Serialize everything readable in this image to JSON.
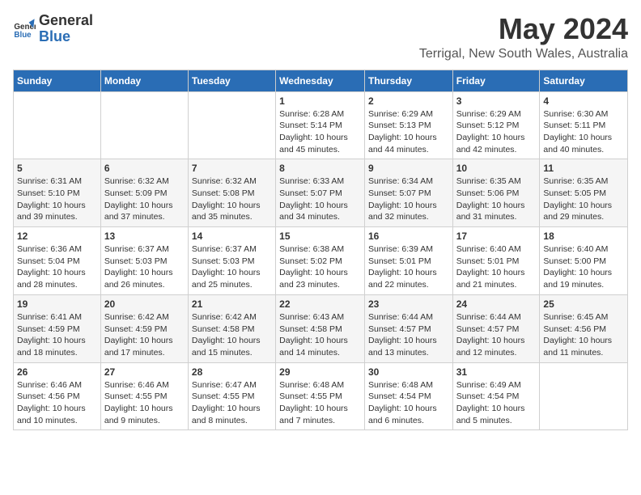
{
  "header": {
    "logo_general": "General",
    "logo_blue": "Blue",
    "title": "May 2024",
    "subtitle": "Terrigal, New South Wales, Australia"
  },
  "columns": [
    "Sunday",
    "Monday",
    "Tuesday",
    "Wednesday",
    "Thursday",
    "Friday",
    "Saturday"
  ],
  "weeks": [
    {
      "days": [
        {
          "num": "",
          "detail": ""
        },
        {
          "num": "",
          "detail": ""
        },
        {
          "num": "",
          "detail": ""
        },
        {
          "num": "1",
          "detail": "Sunrise: 6:28 AM\nSunset: 5:14 PM\nDaylight: 10 hours and 45 minutes."
        },
        {
          "num": "2",
          "detail": "Sunrise: 6:29 AM\nSunset: 5:13 PM\nDaylight: 10 hours and 44 minutes."
        },
        {
          "num": "3",
          "detail": "Sunrise: 6:29 AM\nSunset: 5:12 PM\nDaylight: 10 hours and 42 minutes."
        },
        {
          "num": "4",
          "detail": "Sunrise: 6:30 AM\nSunset: 5:11 PM\nDaylight: 10 hours and 40 minutes."
        }
      ]
    },
    {
      "days": [
        {
          "num": "5",
          "detail": "Sunrise: 6:31 AM\nSunset: 5:10 PM\nDaylight: 10 hours and 39 minutes."
        },
        {
          "num": "6",
          "detail": "Sunrise: 6:32 AM\nSunset: 5:09 PM\nDaylight: 10 hours and 37 minutes."
        },
        {
          "num": "7",
          "detail": "Sunrise: 6:32 AM\nSunset: 5:08 PM\nDaylight: 10 hours and 35 minutes."
        },
        {
          "num": "8",
          "detail": "Sunrise: 6:33 AM\nSunset: 5:07 PM\nDaylight: 10 hours and 34 minutes."
        },
        {
          "num": "9",
          "detail": "Sunrise: 6:34 AM\nSunset: 5:07 PM\nDaylight: 10 hours and 32 minutes."
        },
        {
          "num": "10",
          "detail": "Sunrise: 6:35 AM\nSunset: 5:06 PM\nDaylight: 10 hours and 31 minutes."
        },
        {
          "num": "11",
          "detail": "Sunrise: 6:35 AM\nSunset: 5:05 PM\nDaylight: 10 hours and 29 minutes."
        }
      ]
    },
    {
      "days": [
        {
          "num": "12",
          "detail": "Sunrise: 6:36 AM\nSunset: 5:04 PM\nDaylight: 10 hours and 28 minutes."
        },
        {
          "num": "13",
          "detail": "Sunrise: 6:37 AM\nSunset: 5:03 PM\nDaylight: 10 hours and 26 minutes."
        },
        {
          "num": "14",
          "detail": "Sunrise: 6:37 AM\nSunset: 5:03 PM\nDaylight: 10 hours and 25 minutes."
        },
        {
          "num": "15",
          "detail": "Sunrise: 6:38 AM\nSunset: 5:02 PM\nDaylight: 10 hours and 23 minutes."
        },
        {
          "num": "16",
          "detail": "Sunrise: 6:39 AM\nSunset: 5:01 PM\nDaylight: 10 hours and 22 minutes."
        },
        {
          "num": "17",
          "detail": "Sunrise: 6:40 AM\nSunset: 5:01 PM\nDaylight: 10 hours and 21 minutes."
        },
        {
          "num": "18",
          "detail": "Sunrise: 6:40 AM\nSunset: 5:00 PM\nDaylight: 10 hours and 19 minutes."
        }
      ]
    },
    {
      "days": [
        {
          "num": "19",
          "detail": "Sunrise: 6:41 AM\nSunset: 4:59 PM\nDaylight: 10 hours and 18 minutes."
        },
        {
          "num": "20",
          "detail": "Sunrise: 6:42 AM\nSunset: 4:59 PM\nDaylight: 10 hours and 17 minutes."
        },
        {
          "num": "21",
          "detail": "Sunrise: 6:42 AM\nSunset: 4:58 PM\nDaylight: 10 hours and 15 minutes."
        },
        {
          "num": "22",
          "detail": "Sunrise: 6:43 AM\nSunset: 4:58 PM\nDaylight: 10 hours and 14 minutes."
        },
        {
          "num": "23",
          "detail": "Sunrise: 6:44 AM\nSunset: 4:57 PM\nDaylight: 10 hours and 13 minutes."
        },
        {
          "num": "24",
          "detail": "Sunrise: 6:44 AM\nSunset: 4:57 PM\nDaylight: 10 hours and 12 minutes."
        },
        {
          "num": "25",
          "detail": "Sunrise: 6:45 AM\nSunset: 4:56 PM\nDaylight: 10 hours and 11 minutes."
        }
      ]
    },
    {
      "days": [
        {
          "num": "26",
          "detail": "Sunrise: 6:46 AM\nSunset: 4:56 PM\nDaylight: 10 hours and 10 minutes."
        },
        {
          "num": "27",
          "detail": "Sunrise: 6:46 AM\nSunset: 4:55 PM\nDaylight: 10 hours and 9 minutes."
        },
        {
          "num": "28",
          "detail": "Sunrise: 6:47 AM\nSunset: 4:55 PM\nDaylight: 10 hours and 8 minutes."
        },
        {
          "num": "29",
          "detail": "Sunrise: 6:48 AM\nSunset: 4:55 PM\nDaylight: 10 hours and 7 minutes."
        },
        {
          "num": "30",
          "detail": "Sunrise: 6:48 AM\nSunset: 4:54 PM\nDaylight: 10 hours and 6 minutes."
        },
        {
          "num": "31",
          "detail": "Sunrise: 6:49 AM\nSunset: 4:54 PM\nDaylight: 10 hours and 5 minutes."
        },
        {
          "num": "",
          "detail": ""
        }
      ]
    }
  ]
}
